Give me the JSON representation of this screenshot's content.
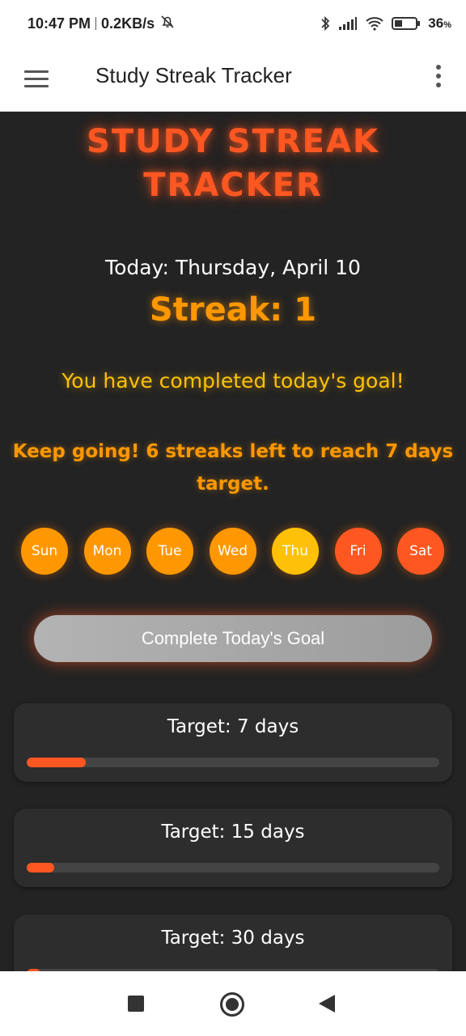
{
  "status_bar": {
    "time": "10:47 PM",
    "network_speed": "0.2KB/s",
    "battery": "36",
    "battery_unit": "%",
    "battery_level_percent": 36,
    "icons": [
      "mute-bell-icon",
      "bluetooth-icon",
      "signal-icon",
      "wifi-icon",
      "battery-icon"
    ]
  },
  "app_bar": {
    "title": "Study Streak Tracker",
    "icons": [
      "hamburger-menu-icon",
      "more-vert-icon"
    ]
  },
  "main": {
    "title_line1": "STUDY STREAK",
    "title_line2": "TRACKER",
    "today": "Today: Thursday, April 10",
    "streak": "Streak: 1",
    "completed_message": "You have completed today's goal!",
    "motivation": "Keep going! 6 streaks left to reach 7 days target.",
    "days": [
      {
        "label": "Sun",
        "color": "#ff9800"
      },
      {
        "label": "Mon",
        "color": "#ff9800"
      },
      {
        "label": "Tue",
        "color": "#ff9800"
      },
      {
        "label": "Wed",
        "color": "#ff9800"
      },
      {
        "label": "Thu",
        "color": "#ffc107"
      },
      {
        "label": "Fri",
        "color": "#ff5722"
      },
      {
        "label": "Sat",
        "color": "#ff5722"
      }
    ],
    "goal_button": "Complete Today's Goal",
    "targets": [
      {
        "label": "Target: 7 days",
        "progress": 0.1429
      },
      {
        "label": "Target: 15 days",
        "progress": 0.0667
      },
      {
        "label": "Target: 30 days",
        "progress": 0.0333
      }
    ]
  },
  "colors": {
    "accent": "#ff5722",
    "streak": "#ff9800",
    "success": "#ffc107",
    "background": "#232323",
    "card": "#2d2d2d"
  },
  "nav_bar": {
    "icons": [
      "recents-square-icon",
      "home-circle-icon",
      "back-triangle-icon"
    ]
  }
}
